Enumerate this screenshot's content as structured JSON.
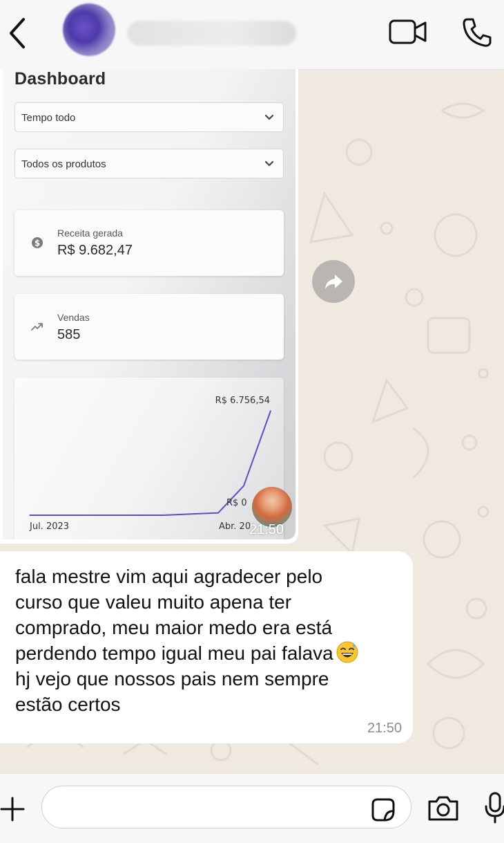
{
  "chat": {
    "contact_name": "",
    "icons": {
      "back": "chevron-left-icon",
      "video": "video-call-icon",
      "call": "phone-icon"
    }
  },
  "image_message": {
    "time": "21:50",
    "dashboard": {
      "title": "Dashboard",
      "filter_period": "Tempo todo",
      "filter_products": "Todos os produtos",
      "revenue": {
        "label": "Receita gerada",
        "value": "R$  9.682,47"
      },
      "sales": {
        "label": "Vendas",
        "value": "585"
      }
    },
    "chart_data": {
      "type": "line",
      "x_labels": [
        "Jul. 2023",
        "Abr. 20"
      ],
      "max_label": "R$  6.756,54",
      "min_label": "R$  0",
      "series": [
        {
          "values": [
            0,
            0,
            0,
            0,
            0,
            150,
            1900,
            6756.54
          ]
        }
      ],
      "ylim": [
        0,
        6756.54
      ],
      "line_color": "#5b4fc9"
    }
  },
  "text_message": {
    "lines": [
      "fala mestre vim aqui agradecer pelo",
      "curso que valeu muito apena ter",
      "comprado, meu maior medo era está",
      "perdendo tempo igual meu pai falava",
      "hj vejo que nossos pais nem sempre",
      "estão certos"
    ],
    "emoji": "grinning-sweat-emoji",
    "time": "21:50"
  },
  "composer": {
    "placeholder": "",
    "icons": {
      "plus": "plus-icon",
      "sticker": "sticker-icon",
      "camera": "camera-icon",
      "mic": "microphone-icon"
    }
  }
}
